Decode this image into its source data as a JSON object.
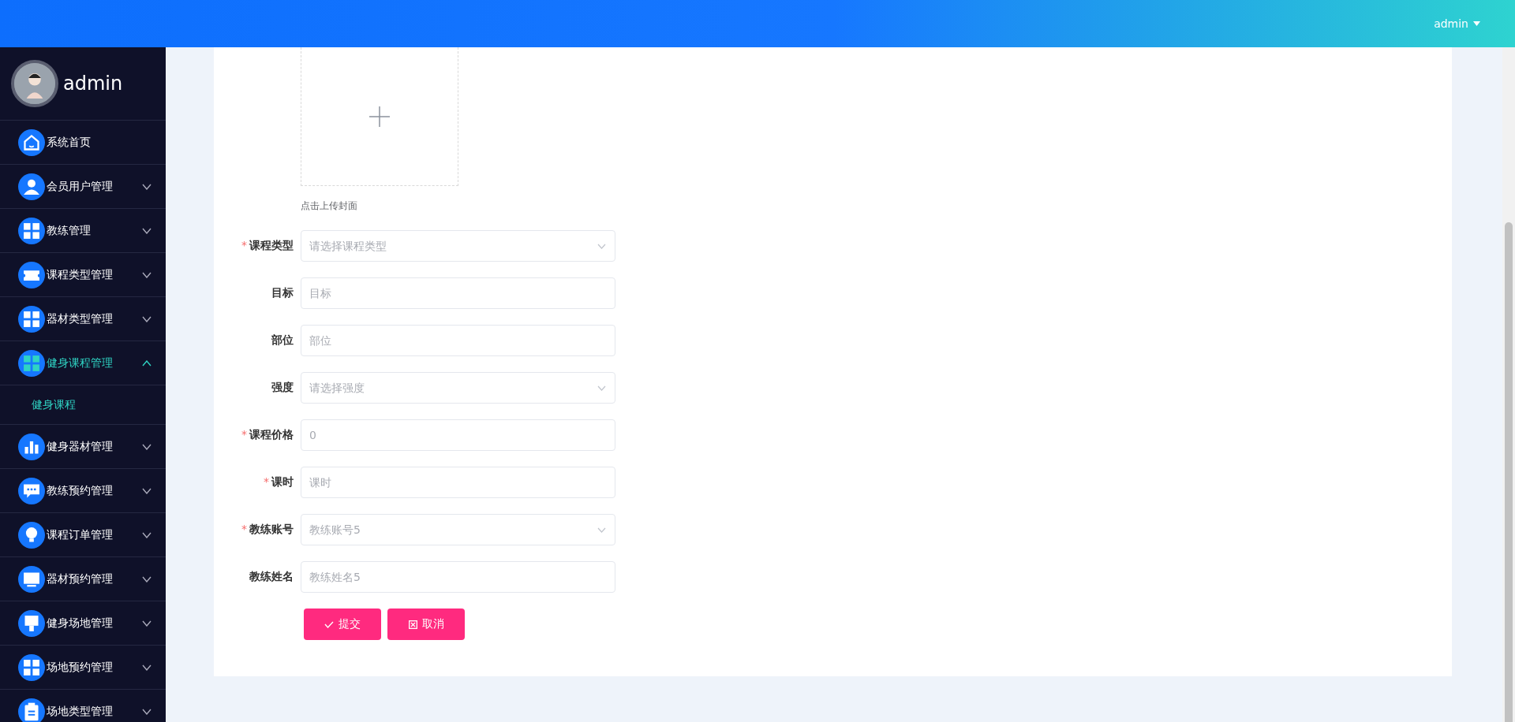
{
  "header": {
    "user": "admin"
  },
  "sidebar": {
    "user": "admin",
    "items": [
      {
        "label": "系统首页",
        "kind": "link",
        "selected": false
      },
      {
        "label": "会员用户管理",
        "kind": "menu",
        "selected": false,
        "expanded": false
      },
      {
        "label": "教练管理",
        "kind": "menu",
        "selected": false,
        "expanded": false
      },
      {
        "label": "课程类型管理",
        "kind": "menu",
        "selected": false,
        "expanded": false
      },
      {
        "label": "器材类型管理",
        "kind": "menu",
        "selected": false,
        "expanded": false
      },
      {
        "label": "健身课程管理",
        "kind": "menu",
        "selected": true,
        "expanded": true,
        "children": [
          {
            "label": "健身课程",
            "selected": true
          }
        ]
      },
      {
        "label": "健身器材管理",
        "kind": "menu",
        "selected": false,
        "expanded": false
      },
      {
        "label": "教练预约管理",
        "kind": "menu",
        "selected": false,
        "expanded": false
      },
      {
        "label": "课程订单管理",
        "kind": "menu",
        "selected": false,
        "expanded": false
      },
      {
        "label": "器材预约管理",
        "kind": "menu",
        "selected": false,
        "expanded": false
      },
      {
        "label": "健身场地管理",
        "kind": "menu",
        "selected": false,
        "expanded": false
      },
      {
        "label": "场地预约管理",
        "kind": "menu",
        "selected": false,
        "expanded": false
      },
      {
        "label": "场地类型管理",
        "kind": "menu",
        "selected": false,
        "expanded": false
      }
    ]
  },
  "form": {
    "upload": {
      "hint": "点击上传封面"
    },
    "fields": [
      {
        "label": "课程类型",
        "required_mark": "*",
        "kind": "select",
        "placeholder": "请选择课程类型"
      },
      {
        "label": "目标",
        "kind": "input",
        "placeholder": "目标"
      },
      {
        "label": "部位",
        "kind": "input",
        "placeholder": "部位"
      },
      {
        "label": "强度",
        "kind": "select",
        "placeholder": "请选择强度"
      },
      {
        "label": "课程价格",
        "required_mark": "*",
        "kind": "input",
        "placeholder": "0"
      },
      {
        "label": "课时",
        "required_mark": "*",
        "kind": "input",
        "placeholder": "课时"
      },
      {
        "label": "教练账号",
        "required_mark": "*",
        "kind": "select",
        "placeholder": "教练账号5"
      },
      {
        "label": "教练姓名",
        "kind": "input",
        "placeholder": "教练姓名5"
      }
    ],
    "buttons": [
      {
        "label": "提交",
        "kind": "submit"
      },
      {
        "label": "取消",
        "kind": "cancel"
      }
    ]
  }
}
